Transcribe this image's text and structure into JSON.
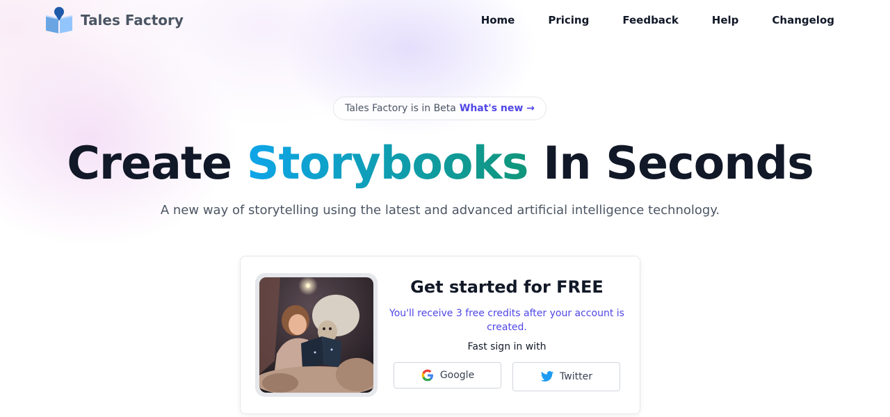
{
  "brand": {
    "name": "Tales Factory",
    "accent": "#4f46e5",
    "logo_icon": "book-pin-icon"
  },
  "nav": {
    "items": [
      {
        "label": "Home"
      },
      {
        "label": "Pricing"
      },
      {
        "label": "Feedback"
      },
      {
        "label": "Help"
      },
      {
        "label": "Changelog"
      }
    ]
  },
  "beta": {
    "text": "Tales Factory is in Beta",
    "link": "What's new →"
  },
  "hero": {
    "title_pre": "Create ",
    "title_highlight": "Storybooks",
    "title_post": " In Seconds",
    "subtitle": "A new way of storytelling using the latest and advanced artificial intelligence technology."
  },
  "signup": {
    "title": "Get started for FREE",
    "credits_text": "You'll receive 3 free credits after your account is created.",
    "fast_sign": "Fast sign in with",
    "google_label": "Google",
    "twitter_label": "Twitter",
    "image_alt": "girl-reading-book-with-sheep-illustration"
  }
}
